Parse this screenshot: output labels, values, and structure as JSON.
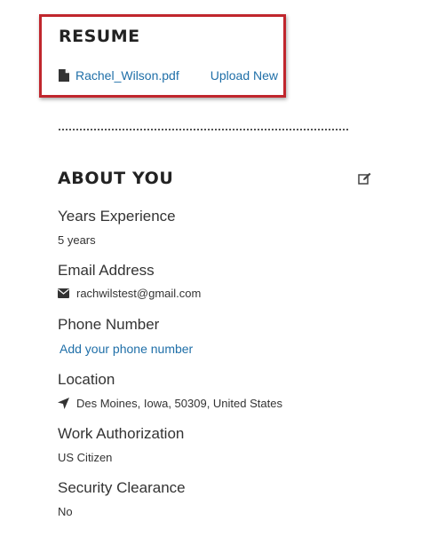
{
  "resume": {
    "title": "RESUME",
    "file_name": "Rachel_Wilson.pdf",
    "upload_label": "Upload New"
  },
  "about": {
    "title": "ABOUT YOU",
    "years_experience": {
      "label": "Years Experience",
      "value": "5 years"
    },
    "email": {
      "label": "Email Address",
      "value": "rachwilstest@gmail.com"
    },
    "phone": {
      "label": "Phone Number",
      "add_link": "Add your phone number"
    },
    "location": {
      "label": "Location",
      "value": "Des Moines, Iowa, 50309, United States"
    },
    "work_authorization": {
      "label": "Work Authorization",
      "value": "US Citizen"
    },
    "security_clearance": {
      "label": "Security Clearance",
      "value": "No"
    }
  },
  "icons": {
    "file": "file-icon",
    "edit": "edit-icon",
    "email": "envelope-icon",
    "location": "location-arrow-icon"
  },
  "colors": {
    "highlight_border": "#c0262d",
    "link": "#1f6fa8",
    "text": "#333333",
    "heading": "#222222"
  }
}
